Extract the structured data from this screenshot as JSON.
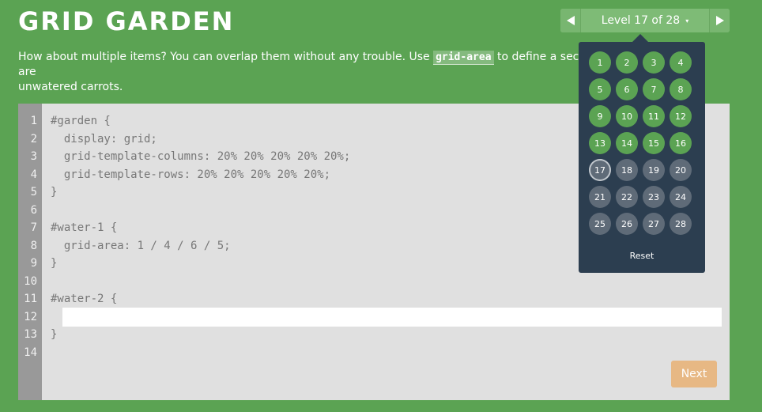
{
  "app": {
    "title": "GRID GARDEN"
  },
  "level_nav": {
    "label": "Level 17 of 28",
    "caret": "▾"
  },
  "instructions": {
    "before": "How about multiple items? You can overlap them without any trouble. Use ",
    "code": "grid-area",
    "after": " to define a second are",
    "line2": "unwatered carrots."
  },
  "editor": {
    "line_numbers": [
      "1",
      "2",
      "3",
      "4",
      "5",
      "6",
      "7",
      "8",
      "9",
      "10",
      "11",
      "12",
      "13",
      "14"
    ],
    "lines": [
      "#garden {",
      "  display: grid;",
      "  grid-template-columns: 20% 20% 20% 20% 20%;",
      "  grid-template-rows: 20% 20% 20% 20% 20%;",
      "}",
      "",
      "#water-1 {",
      "  grid-area: 1 / 4 / 6 / 5;",
      "}",
      "",
      "#water-2 {",
      "",
      "}",
      ""
    ],
    "input_value": "",
    "input_placeholder": ""
  },
  "buttons": {
    "next": "Next",
    "reset": "Reset"
  },
  "levels": [
    {
      "n": "1",
      "state": "done"
    },
    {
      "n": "2",
      "state": "done"
    },
    {
      "n": "3",
      "state": "done"
    },
    {
      "n": "4",
      "state": "done"
    },
    {
      "n": "5",
      "state": "done"
    },
    {
      "n": "6",
      "state": "done"
    },
    {
      "n": "7",
      "state": "done"
    },
    {
      "n": "8",
      "state": "done"
    },
    {
      "n": "9",
      "state": "done"
    },
    {
      "n": "10",
      "state": "done"
    },
    {
      "n": "11",
      "state": "done"
    },
    {
      "n": "12",
      "state": "done"
    },
    {
      "n": "13",
      "state": "done"
    },
    {
      "n": "14",
      "state": "done"
    },
    {
      "n": "15",
      "state": "done"
    },
    {
      "n": "16",
      "state": "done"
    },
    {
      "n": "17",
      "state": "current"
    },
    {
      "n": "18",
      "state": "todo"
    },
    {
      "n": "19",
      "state": "todo"
    },
    {
      "n": "20",
      "state": "todo"
    },
    {
      "n": "21",
      "state": "todo"
    },
    {
      "n": "22",
      "state": "todo"
    },
    {
      "n": "23",
      "state": "todo"
    },
    {
      "n": "24",
      "state": "todo"
    },
    {
      "n": "25",
      "state": "todo"
    },
    {
      "n": "26",
      "state": "todo"
    },
    {
      "n": "27",
      "state": "todo"
    },
    {
      "n": "28",
      "state": "todo"
    }
  ],
  "colors": {
    "background": "#5ba353",
    "popup": "#2c3e50",
    "level_done": "#5ba353",
    "level_todo": "#5f6b78",
    "next_button": "#e7b884"
  },
  "icons": {
    "prev": "triangle-left-icon",
    "next": "triangle-right-icon"
  }
}
